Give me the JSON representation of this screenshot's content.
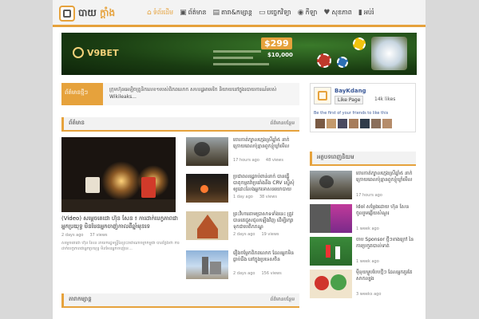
{
  "header": {
    "logo_main": "បាយ",
    "logo_accent": "ក្តាំង",
    "nav": [
      {
        "label": "ទំព័រដើម",
        "icon": "home-icon",
        "glyph": "⌂"
      },
      {
        "label": "ព័ត៌មាន",
        "icon": "newspaper-icon",
        "glyph": "▣"
      },
      {
        "label": "តារា&កម្សាន្ត",
        "icon": "film-icon",
        "glyph": "▤"
      },
      {
        "label": "បច្ចេកវិទ្យា",
        "icon": "laptop-icon",
        "glyph": "▭"
      },
      {
        "label": "កីឡា",
        "icon": "football-icon",
        "glyph": "◉"
      },
      {
        "label": "សុខភាព",
        "icon": "heartbeat-icon",
        "glyph": "♥"
      },
      {
        "label": "អប់រំ",
        "icon": "book-icon",
        "glyph": "▮"
      }
    ]
  },
  "banner": {
    "brand": "V9BET",
    "price": "$299",
    "sub_amount": "$10,000"
  },
  "ticker": {
    "label": "ព័ត៌មានថ្មីៗ",
    "text": "ក្រុមហ៊ុនអេឡិចត្រូនិកលេខ១របស់ពិភពលោក សហរដ្ឋអាមេរិក និយាយនៅក្នុងរបាយការណ៍របស់ Wikileaks...",
    "prev": "‹",
    "next": "›"
  },
  "section_news": {
    "title": "ព័ត៌មាន",
    "more": "ព័ត៌មានបន្ថែម"
  },
  "section_ent": {
    "title": "តារាកម្សាន្ត",
    "more": "ព័ត៌មានបន្ថែម"
  },
  "main_story": {
    "title": "(Video) សម្តេចតេជោ ហ៊ុន សែន ៖ ការដាក់បេក្ខភាពជាអ្នកប្រយុទ្ធ មិនមែនអ្នកចាញ់កាលពីឆ្នាំមុនទេ",
    "date": "2 days ago",
    "views": "37 views",
    "excerpt": "សម្តេចតេជោ ហ៊ុន សែន នាយករដ្ឋមន្ត្រីនៃព្រះរាជាណាចក្រកម្ពុជា បានថ្លែងថា ការដាក់បេក្ខភាពជាអ្នកប្រយុទ្ធ មិនមែនអ្នកចាញ់ទេ..."
  },
  "news_list": [
    {
      "title": "ចោរកាត់ក្បាលក្មេងស្រីឆ្នាំ៥ នាក់ ក្រោយពេលប៉ុន្មានពួកខ្ញុំឃ្លាំមើល",
      "date": "17 hours ago",
      "views": "48 views"
    },
    {
      "title": "ប្រជាពលរដ្ឋរាប់ពាន់នាក់ បានធ្វើបាតុកម្មតវ៉ាប្រឆាំងនឹង CRV ស្នើសុំឲ្យដោះលែងអ្នកទោសនយោបាយ",
      "date": "1 day ago",
      "views": "38 views"
    },
    {
      "title": "ព្រះវិហារតាមប្រាសាទទាំងនេះ ត្រូវបានគេជួសជុលឡើងវិញ ដើម្បីរក្សាទុកជាបេតិកភណ្ឌ",
      "date": "2 days ago",
      "views": "19 views"
    },
    {
      "title": "រឿងចម្លែក​ពិភពលោក ដែលអ្នកមិនធ្លាប់ដឹង នៅក្នុងប្រទេសចិន",
      "date": "2 days ago",
      "views": "156 views"
    }
  ],
  "facebook": {
    "name": "BayKdang",
    "like_label": "Like Page",
    "likes": "14k likes",
    "friends_text": "Be the first of your friends to like this"
  },
  "section_popular": {
    "title": "អត្ថបទពេញនិយម"
  },
  "popular_list": [
    {
      "title": "ចោរកាត់ក្បាលក្មេងស្រីឆ្នាំ៥ នាក់ ក្រោយពេលប៉ុន្មានពួកខ្ញុំឃ្លាំមើល",
      "date": "17 hours ago"
    },
    {
      "title": "Idol សម្តែងដោយ ហ៊ុន សែន ចូលរួមឆ្លើយសំណួរ",
      "date": "1 week ago"
    },
    {
      "title": "ចាប Sponsor ថ្មីៗខាងក្រៅ នៃការប្រកួតបាល់ទាត់",
      "date": "1 week ago"
    },
    {
      "title": "ម៉ឺនុយម្ហូបបែបថ្មីៗ ដែលអ្នកគួរតែសាកល្បង",
      "date": "3 weeks ago"
    }
  ],
  "colors": {
    "accent": "#e6a23c",
    "facebook": "#3b5998"
  }
}
